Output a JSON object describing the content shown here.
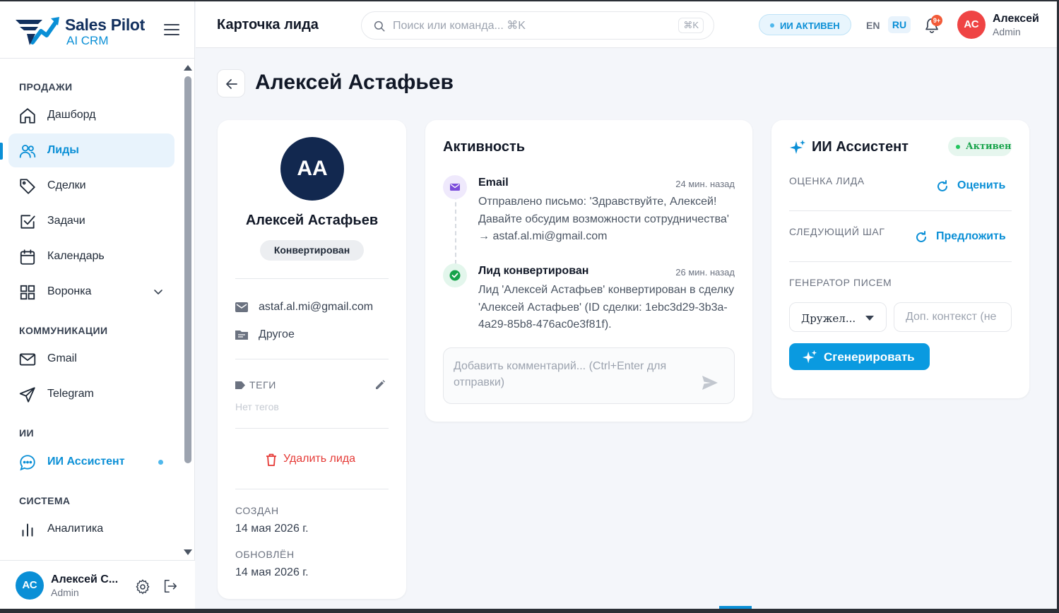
{
  "app": {
    "logo_title": "Sales Pilot",
    "logo_sub": "AI CRM"
  },
  "sidebar": {
    "sections": {
      "sales": "ПРОДАЖИ",
      "comms": "КОММУНИКАЦИИ",
      "ai": "ИИ",
      "system": "СИСТЕМА"
    },
    "items": {
      "dashboard": "Дашборд",
      "leads": "Лиды",
      "deals": "Сделки",
      "tasks": "Задачи",
      "calendar": "Календарь",
      "funnel": "Воронка",
      "gmail": "Gmail",
      "telegram": "Telegram",
      "ai_assistant": "ИИ Ассистент",
      "analytics": "Аналитика"
    },
    "active_item": "leads",
    "user": {
      "initials": "АС",
      "name": "Алексей С...",
      "role": "Admin"
    }
  },
  "topbar": {
    "page_title": "Карточка лида",
    "search_placeholder": "Поиск или команда... ⌘K",
    "search_kbd": "⌘K",
    "ai_status": "ИИ АКТИВЕН",
    "lang_en": "EN",
    "lang_ru": "RU",
    "notifications_badge": "9+",
    "user": {
      "initials": "АС",
      "name": "Алексей",
      "role": "Admin"
    }
  },
  "lead": {
    "title": "Алексей Астафьев",
    "initials": "АА",
    "name": "Алексей Астафьев",
    "status": "Конвертирован",
    "email": "astaf.al.mi@gmail.com",
    "source": "Другое",
    "tags_label": "ТЕГИ",
    "no_tags": "Нет тегов",
    "delete_label": "Удалить лида",
    "created_label": "СОЗДАН",
    "created_value": "14 мая 2026 г.",
    "updated_label": "ОБНОВЛЁН",
    "updated_value": "14 мая 2026 г."
  },
  "activity": {
    "title": "Активность",
    "items": [
      {
        "type": "Email",
        "time": "24 мин. назад",
        "text": "Отправлено письмо: 'Здравствуйте, Алексей! Давайте обсудим возможности сотрудничества' → astaf.al.mi@gmail.com"
      },
      {
        "type": "Лид конвертирован",
        "time": "26 мин. назад",
        "text": "Лид 'Алексей Астафьев' конвертирован в сделку 'Алексей Астафьев' (ID сделки: 1ebc3d29-3b3a-4a29-85b8-476ac0e3f81f)."
      }
    ],
    "comment_placeholder": "Добавить комментарий... (Ctrl+Enter для отправки)"
  },
  "assistant": {
    "title": "ИИ Ассистент",
    "status": "Активен",
    "score_label": "ОЦЕНКА ЛИДА",
    "score_action": "Оценить",
    "next_step_label": "СЛЕДУЮЩИЙ ШАГ",
    "next_step_action": "Предложить",
    "email_gen_label": "ГЕНЕРАТОР ПИСЕМ",
    "tone_value": "Дружел...",
    "context_placeholder": "Доп. контекст (не",
    "generate_label": "Сгенерировать"
  },
  "colors": {
    "accent": "#0a8fd6",
    "navy": "#12284f",
    "danger": "#e53935",
    "success": "#16a34a"
  }
}
